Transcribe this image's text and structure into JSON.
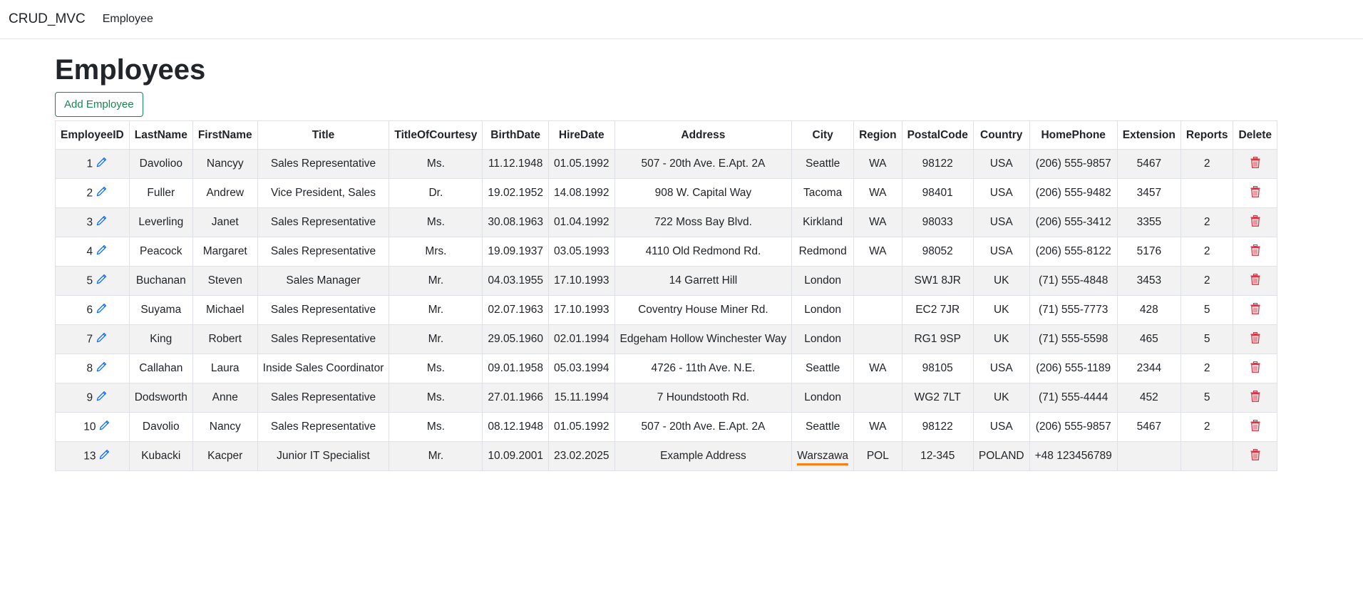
{
  "nav": {
    "brand": "CRUD_MVC",
    "link": "Employee"
  },
  "page": {
    "title": "Employees",
    "add_button": "Add Employee"
  },
  "colors": {
    "accent": "#198754",
    "edit_icon": "#0d6efd",
    "delete_icon": "#dc3545",
    "highlight": "#fd7e14"
  },
  "table": {
    "headers": [
      "EmployeeID",
      "LastName",
      "FirstName",
      "Title",
      "TitleOfCourtesy",
      "BirthDate",
      "HireDate",
      "Address",
      "City",
      "Region",
      "PostalCode",
      "Country",
      "HomePhone",
      "Extension",
      "Reports",
      "Delete"
    ],
    "rows": [
      [
        "1",
        "Davolioo",
        "Nancyy",
        "Sales Representative",
        "Ms.",
        "11.12.1948",
        "01.05.1992",
        "507 - 20th Ave. E.Apt. 2A",
        "Seattle",
        "WA",
        "98122",
        "USA",
        "(206) 555-9857",
        "5467",
        "2"
      ],
      [
        "2",
        "Fuller",
        "Andrew",
        "Vice President, Sales",
        "Dr.",
        "19.02.1952",
        "14.08.1992",
        "908 W. Capital Way",
        "Tacoma",
        "WA",
        "98401",
        "USA",
        "(206) 555-9482",
        "3457",
        ""
      ],
      [
        "3",
        "Leverling",
        "Janet",
        "Sales Representative",
        "Ms.",
        "30.08.1963",
        "01.04.1992",
        "722 Moss Bay Blvd.",
        "Kirkland",
        "WA",
        "98033",
        "USA",
        "(206) 555-3412",
        "3355",
        "2"
      ],
      [
        "4",
        "Peacock",
        "Margaret",
        "Sales Representative",
        "Mrs.",
        "19.09.1937",
        "03.05.1993",
        "4110 Old Redmond Rd.",
        "Redmond",
        "WA",
        "98052",
        "USA",
        "(206) 555-8122",
        "5176",
        "2"
      ],
      [
        "5",
        "Buchanan",
        "Steven",
        "Sales Manager",
        "Mr.",
        "04.03.1955",
        "17.10.1993",
        "14 Garrett Hill",
        "London",
        "",
        "SW1 8JR",
        "UK",
        "(71) 555-4848",
        "3453",
        "2"
      ],
      [
        "6",
        "Suyama",
        "Michael",
        "Sales Representative",
        "Mr.",
        "02.07.1963",
        "17.10.1993",
        "Coventry House Miner Rd.",
        "London",
        "",
        "EC2 7JR",
        "UK",
        "(71) 555-7773",
        "428",
        "5"
      ],
      [
        "7",
        "King",
        "Robert",
        "Sales Representative",
        "Mr.",
        "29.05.1960",
        "02.01.1994",
        "Edgeham Hollow Winchester Way",
        "London",
        "",
        "RG1 9SP",
        "UK",
        "(71) 555-5598",
        "465",
        "5"
      ],
      [
        "8",
        "Callahan",
        "Laura",
        "Inside Sales Coordinator",
        "Ms.",
        "09.01.1958",
        "05.03.1994",
        "4726 - 11th Ave. N.E.",
        "Seattle",
        "WA",
        "98105",
        "USA",
        "(206) 555-1189",
        "2344",
        "2"
      ],
      [
        "9",
        "Dodsworth",
        "Anne",
        "Sales Representative",
        "Ms.",
        "27.01.1966",
        "15.11.1994",
        "7 Houndstooth Rd.",
        "London",
        "",
        "WG2 7LT",
        "UK",
        "(71) 555-4444",
        "452",
        "5"
      ],
      [
        "10",
        "Davolio",
        "Nancy",
        "Sales Representative",
        "Ms.",
        "08.12.1948",
        "01.05.1992",
        "507 - 20th Ave. E.Apt. 2A",
        "Seattle",
        "WA",
        "98122",
        "USA",
        "(206) 555-9857",
        "5467",
        "2"
      ],
      [
        "13",
        "Kubacki",
        "Kacper",
        "Junior IT Specialist",
        "Mr.",
        "10.09.2001",
        "23.02.2025",
        "Example Address",
        "Warszawa",
        "POL",
        "12-345",
        "POLAND",
        "+48 123456789",
        "",
        ""
      ]
    ]
  }
}
